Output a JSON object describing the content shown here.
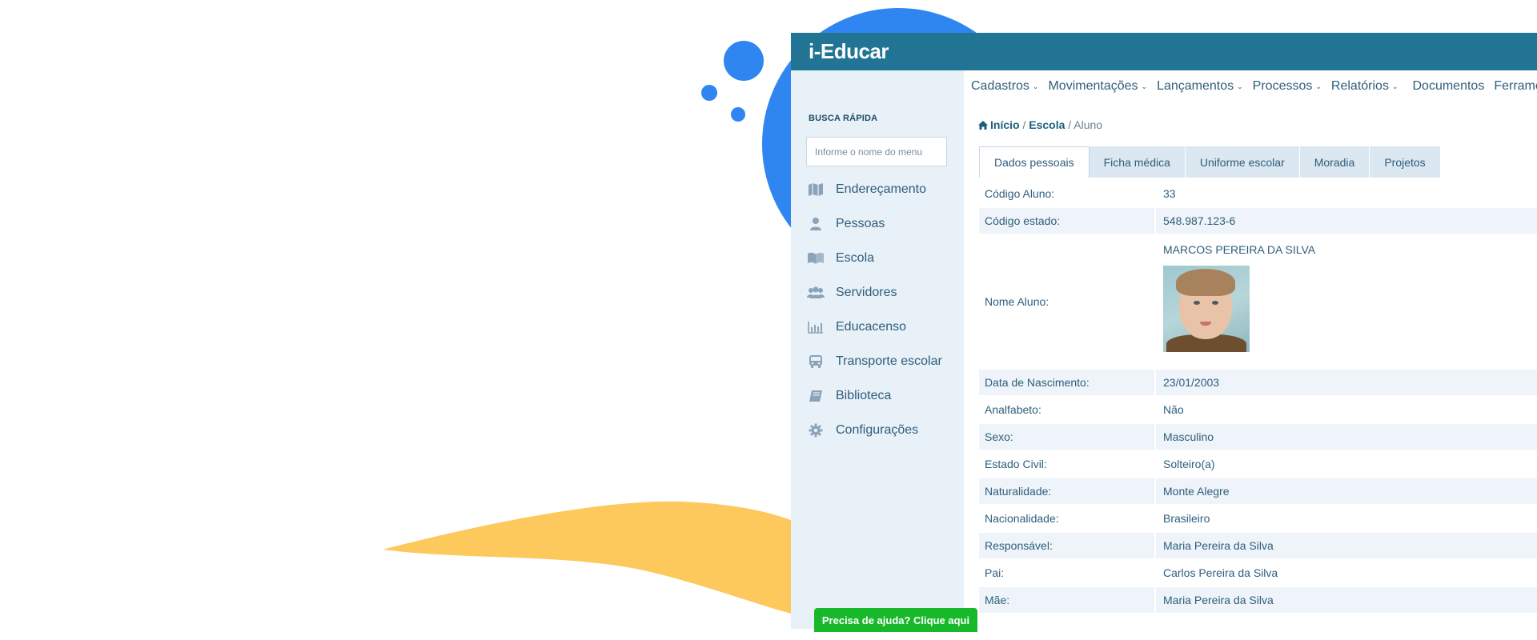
{
  "app": {
    "title": "i-Educar"
  },
  "sidebar": {
    "search_label": "BUSCA RÁPIDA",
    "search_placeholder": "Informe o nome do menu",
    "items": [
      {
        "label": "Endereçamento",
        "icon": "map-icon"
      },
      {
        "label": "Pessoas",
        "icon": "user-icon"
      },
      {
        "label": "Escola",
        "icon": "book-open-icon"
      },
      {
        "label": "Servidores",
        "icon": "users-icon"
      },
      {
        "label": "Educacenso",
        "icon": "bar-chart-icon"
      },
      {
        "label": "Transporte escolar",
        "icon": "bus-icon"
      },
      {
        "label": "Biblioteca",
        "icon": "book-icon"
      },
      {
        "label": "Configurações",
        "icon": "gear-icon"
      }
    ]
  },
  "nav": {
    "items": [
      {
        "label": "Cadastros",
        "dropdown": true
      },
      {
        "label": "Movimentações",
        "dropdown": true
      },
      {
        "label": "Lançamentos",
        "dropdown": true
      },
      {
        "label": "Processos",
        "dropdown": true
      },
      {
        "label": "Relatórios",
        "dropdown": true
      },
      {
        "label": "Documentos",
        "dropdown": false
      },
      {
        "label": "Ferramentas",
        "dropdown": false
      }
    ]
  },
  "breadcrumb": {
    "home": "Início",
    "school": "Escola",
    "current": "Aluno",
    "separator": "/"
  },
  "tabs": [
    {
      "label": "Dados pessoais",
      "active": true
    },
    {
      "label": "Ficha médica",
      "active": false
    },
    {
      "label": "Uniforme escolar",
      "active": false
    },
    {
      "label": "Moradia",
      "active": false
    },
    {
      "label": "Projetos",
      "active": false
    }
  ],
  "student": {
    "codigo_aluno": {
      "label": "Código Aluno:",
      "value": "33"
    },
    "codigo_estado": {
      "label": "Código estado:",
      "value": "548.987.123-6"
    },
    "nome_aluno": {
      "label": "Nome Aluno:",
      "value": "MARCOS PEREIRA DA SILVA"
    },
    "data_nascimento": {
      "label": "Data de Nascimento:",
      "value": "23/01/2003"
    },
    "analfabeto": {
      "label": "Analfabeto:",
      "value": "Não"
    },
    "sexo": {
      "label": "Sexo:",
      "value": "Masculino"
    },
    "estado_civil": {
      "label": "Estado Civil:",
      "value": "Solteiro(a)"
    },
    "naturalidade": {
      "label": "Naturalidade:",
      "value": "Monte Alegre"
    },
    "nacionalidade": {
      "label": "Nacionalidade:",
      "value": "Brasileiro"
    },
    "responsavel": {
      "label": "Responsável:",
      "value": "Maria Pereira da Silva"
    },
    "pai": {
      "label": "Pai:",
      "value": "Carlos Pereira da Silva"
    },
    "mae": {
      "label": "Mãe:",
      "value": "Maria Pereira da Silva"
    }
  },
  "help": {
    "label": "Precisa de ajuda? Clique aqui"
  },
  "colors": {
    "topbar": "#217493",
    "sidebar_bg": "#e8f0f8",
    "accent_blue": "#2f86f0",
    "wave_yellow": "#fdc85c",
    "help_green": "#17b92b"
  }
}
